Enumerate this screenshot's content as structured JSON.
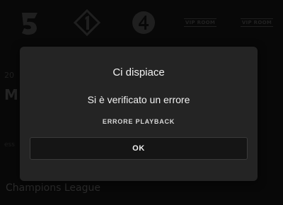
{
  "channels": [
    {
      "icon": "canale5-logo-icon"
    },
    {
      "icon": "italia1-logo-icon"
    },
    {
      "icon": "rete4-logo-icon"
    },
    {
      "icon": "tv-channel-logo-icon",
      "label": "VIP ROOM"
    },
    {
      "icon": "tv-channel-logo-icon",
      "label": "VIP ROOM"
    }
  ],
  "background": {
    "date_fragment": "20",
    "title_fragment": "M",
    "line_fragment": "ess",
    "section_heading": "Champions League"
  },
  "dialog": {
    "title": "Ci dispiace",
    "message": "Si è verificato un errore",
    "error_code": "ERRORE PLAYBACK",
    "ok_label": "OK"
  },
  "colors": {
    "dialog_bg": "#242424",
    "button_bg": "#151515",
    "text": "#f2f2f2"
  }
}
